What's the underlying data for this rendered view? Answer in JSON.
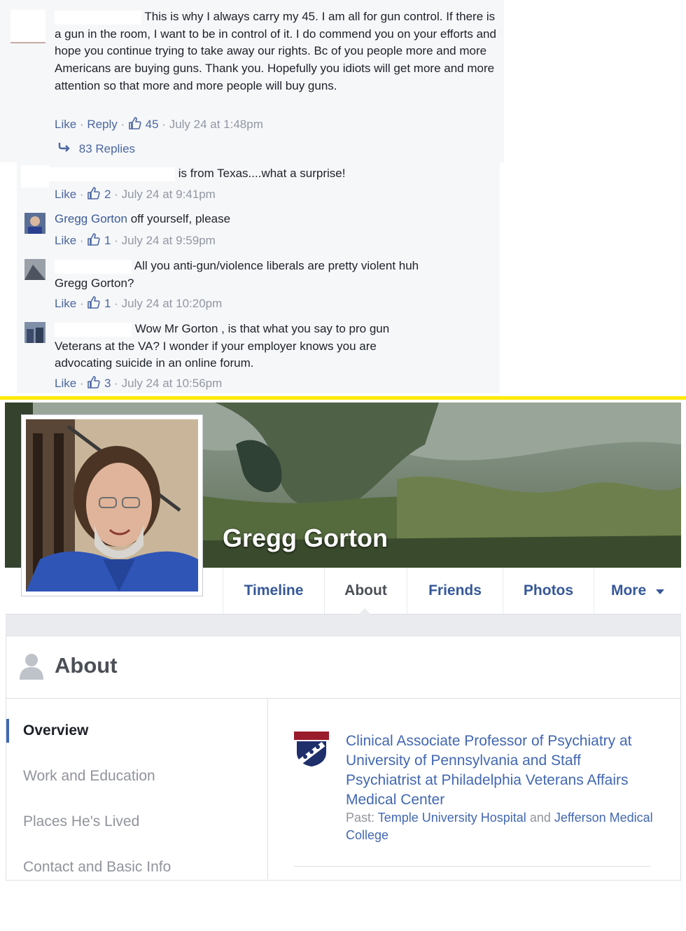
{
  "thread": {
    "main_comment": {
      "text_line1": "This is why I always carry my 45. I am all for gun control. If",
      "text_rest": "there is a gun in the room, I want to be in control of it. I do commend you on your efforts and hope you continue trying to take away our rights. Bc of you people more and more Americans are buying guns. Thank you. Hopefully you idiots will get more and more attention so that more and more people will buy guns.",
      "like_label": "Like",
      "reply_label": "Reply",
      "like_count": "45",
      "timestamp": "July 24 at 1:48pm",
      "replies_label": "83 Replies"
    },
    "replies": [
      {
        "text": "is from Texas....what a surprise!",
        "like_label": "Like",
        "like_count": "2",
        "timestamp": "July 24 at 9:41pm"
      },
      {
        "author": "Gregg Gorton",
        "text": "off yourself, please",
        "like_label": "Like",
        "like_count": "1",
        "timestamp": "July 24 at 9:59pm"
      },
      {
        "text_line1": "All you anti-gun/violence liberals are pretty violent huh",
        "text_line2": "Gregg Gorton?",
        "like_label": "Like",
        "like_count": "1",
        "timestamp": "July 24 at 10:20pm"
      },
      {
        "text_line1": "Wow Mr Gorton , is that what you say to pro gun",
        "text_rest": "Veterans at the VA? I wonder if your employer knows you are advocating suicide in an online forum.",
        "like_label": "Like",
        "like_count": "3",
        "timestamp": "July 24 at 10:56pm"
      }
    ]
  },
  "profile": {
    "name": "Gregg Gorton",
    "tabs": [
      "Timeline",
      "About",
      "Friends",
      "Photos",
      "More"
    ],
    "active_tab": "About"
  },
  "about": {
    "title": "About",
    "sidebar": [
      "Overview",
      "Work and Education",
      "Places He's Lived",
      "Contact and Basic Info"
    ],
    "work": {
      "title": "Clinical Associate Professor of Psychiatry at University of Pennsylvania and Staff Psychiatrist at Philadelphia Veterans Affairs Medical Center",
      "past_label": "Past:",
      "past_1": "Temple University Hospital",
      "and_label": "and",
      "past_2": "Jefferson Medical College"
    }
  },
  "colors": {
    "divider": "#ffea00",
    "link": "#4267b2",
    "comment_bg": "#f6f7f9"
  }
}
